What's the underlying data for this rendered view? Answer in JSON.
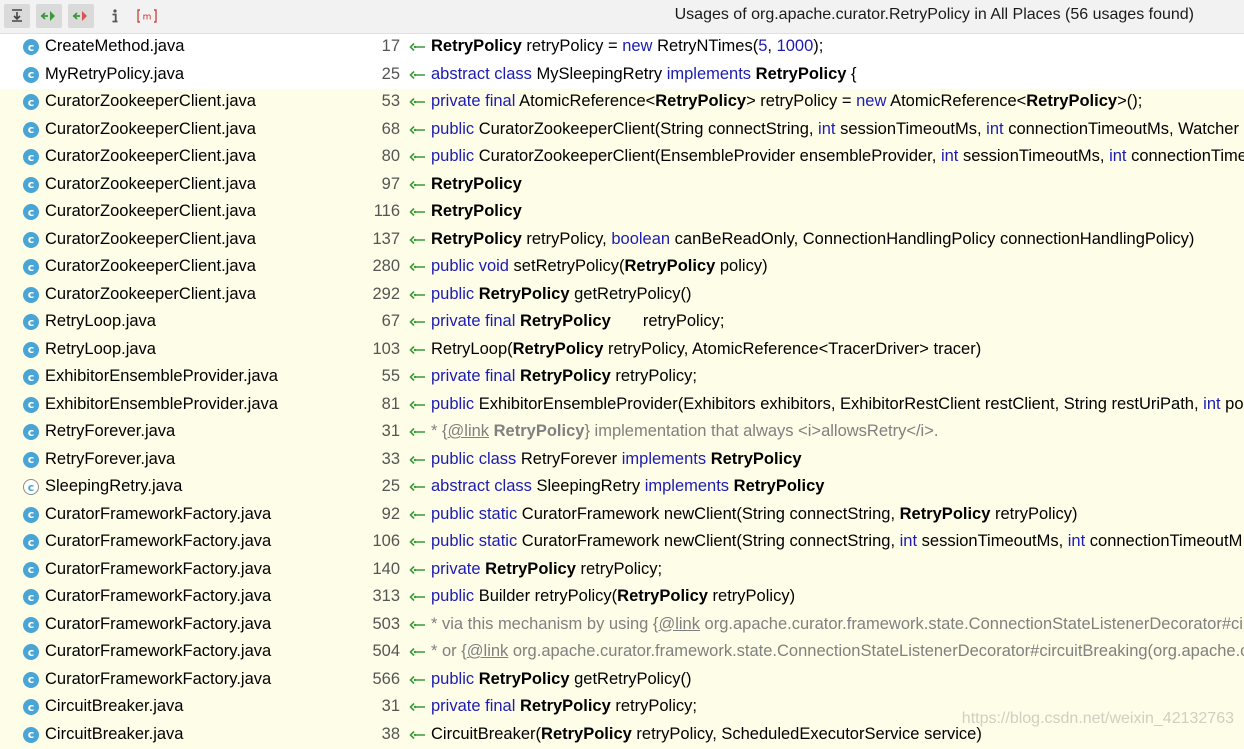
{
  "toolbar": {
    "title": "Usages of org.apache.curator.RetryPolicy in All Places (56 usages found)",
    "buttons": [
      {
        "name": "collapse-all-icon",
        "pressed": true
      },
      {
        "name": "previous-occurrence-icon",
        "pressed": true
      },
      {
        "name": "next-occurrence-icon",
        "pressed": true
      },
      {
        "name": "info-icon",
        "pressed": false
      },
      {
        "name": "method-filter-icon",
        "pressed": false
      }
    ]
  },
  "rows": [
    {
      "file": "CreateMethod.java",
      "line": "17",
      "hl": false,
      "abs": false,
      "code": [
        [
          "hl",
          "RetryPolicy"
        ],
        [
          "t",
          " retryPolicy = "
        ],
        [
          "kw",
          "new"
        ],
        [
          "t",
          " RetryNTimes("
        ],
        [
          "num",
          "5"
        ],
        [
          "t",
          ", "
        ],
        [
          "num",
          "1000"
        ],
        [
          "t",
          ");"
        ]
      ]
    },
    {
      "file": "MyRetryPolicy.java",
      "line": "25",
      "hl": false,
      "abs": false,
      "code": [
        [
          "kw",
          "abstract class"
        ],
        [
          "t",
          " MySleepingRetry "
        ],
        [
          "kw",
          "implements"
        ],
        [
          "t",
          " "
        ],
        [
          "hl",
          "RetryPolicy"
        ],
        [
          "t",
          " {"
        ]
      ]
    },
    {
      "file": "CuratorZookeeperClient.java",
      "line": "53",
      "hl": true,
      "abs": false,
      "code": [
        [
          "kw",
          "private final"
        ],
        [
          "t",
          " AtomicReference<"
        ],
        [
          "hl",
          "RetryPolicy"
        ],
        [
          "t",
          "> retryPolicy = "
        ],
        [
          "kw",
          "new"
        ],
        [
          "t",
          " AtomicReference<"
        ],
        [
          "hl",
          "RetryPolicy"
        ],
        [
          "t",
          ">();"
        ]
      ]
    },
    {
      "file": "CuratorZookeeperClient.java",
      "line": "68",
      "hl": true,
      "abs": false,
      "code": [
        [
          "kw",
          "public"
        ],
        [
          "t",
          " CuratorZookeeperClient(String connectString, "
        ],
        [
          "kw",
          "int"
        ],
        [
          "t",
          " sessionTimeoutMs, "
        ],
        [
          "kw",
          "int"
        ],
        [
          "t",
          " connectionTimeoutMs, Watcher"
        ]
      ]
    },
    {
      "file": "CuratorZookeeperClient.java",
      "line": "80",
      "hl": true,
      "abs": false,
      "code": [
        [
          "kw",
          "public"
        ],
        [
          "t",
          " CuratorZookeeperClient(EnsembleProvider ensembleProvider, "
        ],
        [
          "kw",
          "int"
        ],
        [
          "t",
          " sessionTimeoutMs, "
        ],
        [
          "kw",
          "int"
        ],
        [
          "t",
          " connectionTime"
        ]
      ]
    },
    {
      "file": "CuratorZookeeperClient.java",
      "line": "97",
      "hl": true,
      "abs": false,
      "code": [
        [
          "hl",
          "RetryPolicy"
        ]
      ]
    },
    {
      "file": "CuratorZookeeperClient.java",
      "line": "116",
      "hl": true,
      "abs": false,
      "code": [
        [
          "hl",
          "RetryPolicy"
        ]
      ]
    },
    {
      "file": "CuratorZookeeperClient.java",
      "line": "137",
      "hl": true,
      "abs": false,
      "code": [
        [
          "hl",
          "RetryPolicy"
        ],
        [
          "t",
          " retryPolicy, "
        ],
        [
          "kw",
          "boolean"
        ],
        [
          "t",
          " canBeReadOnly, ConnectionHandlingPolicy connectionHandlingPolicy)"
        ]
      ]
    },
    {
      "file": "CuratorZookeeperClient.java",
      "line": "280",
      "hl": true,
      "abs": false,
      "code": [
        [
          "kw",
          "public void"
        ],
        [
          "t",
          " setRetryPolicy("
        ],
        [
          "hl",
          "RetryPolicy"
        ],
        [
          "t",
          " policy)"
        ]
      ]
    },
    {
      "file": "CuratorZookeeperClient.java",
      "line": "292",
      "hl": true,
      "abs": false,
      "code": [
        [
          "kw",
          "public"
        ],
        [
          "t",
          " "
        ],
        [
          "hl",
          "RetryPolicy"
        ],
        [
          "t",
          " getRetryPolicy()"
        ]
      ]
    },
    {
      "file": "RetryLoop.java",
      "line": "67",
      "hl": true,
      "abs": false,
      "code": [
        [
          "kw",
          "private final"
        ],
        [
          "t",
          " "
        ],
        [
          "hl",
          "RetryPolicy"
        ],
        [
          "t",
          "       retryPolicy;"
        ]
      ]
    },
    {
      "file": "RetryLoop.java",
      "line": "103",
      "hl": true,
      "abs": false,
      "code": [
        [
          "t",
          "RetryLoop("
        ],
        [
          "hl",
          "RetryPolicy"
        ],
        [
          "t",
          " retryPolicy, AtomicReference<TracerDriver> tracer)"
        ]
      ]
    },
    {
      "file": "ExhibitorEnsembleProvider.java",
      "line": "55",
      "hl": true,
      "abs": false,
      "code": [
        [
          "kw",
          "private final"
        ],
        [
          "t",
          " "
        ],
        [
          "hl",
          "RetryPolicy"
        ],
        [
          "t",
          " retryPolicy;"
        ]
      ]
    },
    {
      "file": "ExhibitorEnsembleProvider.java",
      "line": "81",
      "hl": true,
      "abs": false,
      "code": [
        [
          "kw",
          "public"
        ],
        [
          "t",
          " ExhibitorEnsembleProvider(Exhibitors exhibitors, ExhibitorRestClient restClient, String restUriPath, "
        ],
        [
          "kw",
          "int"
        ],
        [
          "t",
          " pol"
        ]
      ]
    },
    {
      "file": "RetryForever.java",
      "line": "31",
      "hl": true,
      "abs": false,
      "code": [
        [
          "cm",
          "* {"
        ],
        [
          "tag",
          "@link"
        ],
        [
          "cm",
          " "
        ],
        [
          "hlc",
          "RetryPolicy"
        ],
        [
          "cm",
          "} implementation that always <i>allowsRetry</i>."
        ]
      ]
    },
    {
      "file": "RetryForever.java",
      "line": "33",
      "hl": true,
      "abs": false,
      "code": [
        [
          "kw",
          "public class"
        ],
        [
          "t",
          " RetryForever "
        ],
        [
          "kw",
          "implements"
        ],
        [
          "t",
          " "
        ],
        [
          "hl",
          "RetryPolicy"
        ]
      ]
    },
    {
      "file": "SleepingRetry.java",
      "line": "25",
      "hl": true,
      "abs": true,
      "code": [
        [
          "kw",
          "abstract class"
        ],
        [
          "t",
          " SleepingRetry "
        ],
        [
          "kw",
          "implements"
        ],
        [
          "t",
          " "
        ],
        [
          "hl",
          "RetryPolicy"
        ]
      ]
    },
    {
      "file": "CuratorFrameworkFactory.java",
      "line": "92",
      "hl": true,
      "abs": false,
      "code": [
        [
          "kw",
          "public static"
        ],
        [
          "t",
          " CuratorFramework newClient(String connectString, "
        ],
        [
          "hl",
          "RetryPolicy"
        ],
        [
          "t",
          " retryPolicy)"
        ]
      ]
    },
    {
      "file": "CuratorFrameworkFactory.java",
      "line": "106",
      "hl": true,
      "abs": false,
      "code": [
        [
          "kw",
          "public static"
        ],
        [
          "t",
          " CuratorFramework newClient(String connectString, "
        ],
        [
          "kw",
          "int"
        ],
        [
          "t",
          " sessionTimeoutMs, "
        ],
        [
          "kw",
          "int"
        ],
        [
          "t",
          " connectionTimeoutM"
        ]
      ]
    },
    {
      "file": "CuratorFrameworkFactory.java",
      "line": "140",
      "hl": true,
      "abs": false,
      "code": [
        [
          "kw",
          "private"
        ],
        [
          "t",
          " "
        ],
        [
          "hl",
          "RetryPolicy"
        ],
        [
          "t",
          " retryPolicy;"
        ]
      ]
    },
    {
      "file": "CuratorFrameworkFactory.java",
      "line": "313",
      "hl": true,
      "abs": false,
      "code": [
        [
          "kw",
          "public"
        ],
        [
          "t",
          " Builder retryPolicy("
        ],
        [
          "hl",
          "RetryPolicy"
        ],
        [
          "t",
          " retryPolicy)"
        ]
      ]
    },
    {
      "file": "CuratorFrameworkFactory.java",
      "line": "503",
      "hl": true,
      "abs": false,
      "code": [
        [
          "cm",
          "* via this mechanism by using {"
        ],
        [
          "tag",
          "@link"
        ],
        [
          "cm",
          " org.apache.curator.framework.state.ConnectionStateListenerDecorator#cir"
        ]
      ]
    },
    {
      "file": "CuratorFrameworkFactory.java",
      "line": "504",
      "hl": true,
      "abs": false,
      "code": [
        [
          "cm",
          "* or {"
        ],
        [
          "tag",
          "@link"
        ],
        [
          "cm",
          " org.apache.curator.framework.state.ConnectionStateListenerDecorator#circuitBreaking(org.apache.c"
        ]
      ]
    },
    {
      "file": "CuratorFrameworkFactory.java",
      "line": "566",
      "hl": true,
      "abs": false,
      "code": [
        [
          "kw",
          "public"
        ],
        [
          "t",
          " "
        ],
        [
          "hl",
          "RetryPolicy"
        ],
        [
          "t",
          " getRetryPolicy()"
        ]
      ]
    },
    {
      "file": "CircuitBreaker.java",
      "line": "31",
      "hl": true,
      "abs": false,
      "code": [
        [
          "kw",
          "private final"
        ],
        [
          "t",
          " "
        ],
        [
          "hl",
          "RetryPolicy"
        ],
        [
          "t",
          " retryPolicy;"
        ]
      ]
    },
    {
      "file": "CircuitBreaker.java",
      "line": "38",
      "hl": true,
      "abs": false,
      "code": [
        [
          "t",
          "CircuitBreaker("
        ],
        [
          "hl",
          "RetryPolicy"
        ],
        [
          "t",
          " retryPolicy, ScheduledExecutorService service)"
        ]
      ]
    }
  ],
  "watermark": "https://blog.csdn.net/weixin_42132763",
  "colors": {
    "keyword": "#1c1cb0",
    "class_icon": "#48a5d6",
    "highlight_row": "#fefde7",
    "usage_arrow": "#3a9a3a"
  }
}
